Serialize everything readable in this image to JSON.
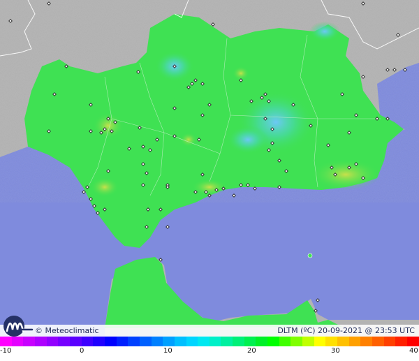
{
  "map": {
    "region": "Andalucía",
    "colors": {
      "sea": "#7f8bdd",
      "land_outside": "#b3b3b3",
      "land_main": "#3fe153",
      "land_cool": "#49d7ae",
      "land_warm": "#a8df4b"
    }
  },
  "footer": {
    "logo_icon": "meteoclimatic-m-icon",
    "brand": "© Meteoclimatic",
    "caption": "DLTM (ºC)  20-09-2021 @ 23:53 UTC"
  },
  "scale": {
    "min": -10,
    "max": 40,
    "colors": [
      "#ff00ff",
      "#e400ff",
      "#c800ff",
      "#ae00ff",
      "#9200ff",
      "#7600ff",
      "#5a00ff",
      "#3d00ff",
      "#2000ff",
      "#0000ff",
      "#0020ff",
      "#0040ff",
      "#0060ff",
      "#0080ff",
      "#00a0ff",
      "#00bfff",
      "#00d5ff",
      "#00e8f0",
      "#00f0c8",
      "#00f0a0",
      "#00f078",
      "#00f050",
      "#00f028",
      "#00ff00",
      "#40ff00",
      "#80ff00",
      "#c0ff00",
      "#ffff00",
      "#ffe000",
      "#ffc000",
      "#ffa000",
      "#ff8000",
      "#ff6000",
      "#ff4000",
      "#ff2000",
      "#ff0000"
    ],
    "labels": [
      {
        "text": "-10",
        "value": -10
      },
      {
        "text": "0",
        "value": 0
      },
      {
        "text": "10",
        "value": 10
      },
      {
        "text": "20",
        "value": 20
      },
      {
        "text": "30",
        "value": 30
      },
      {
        "text": "40",
        "value": 40
      }
    ]
  }
}
